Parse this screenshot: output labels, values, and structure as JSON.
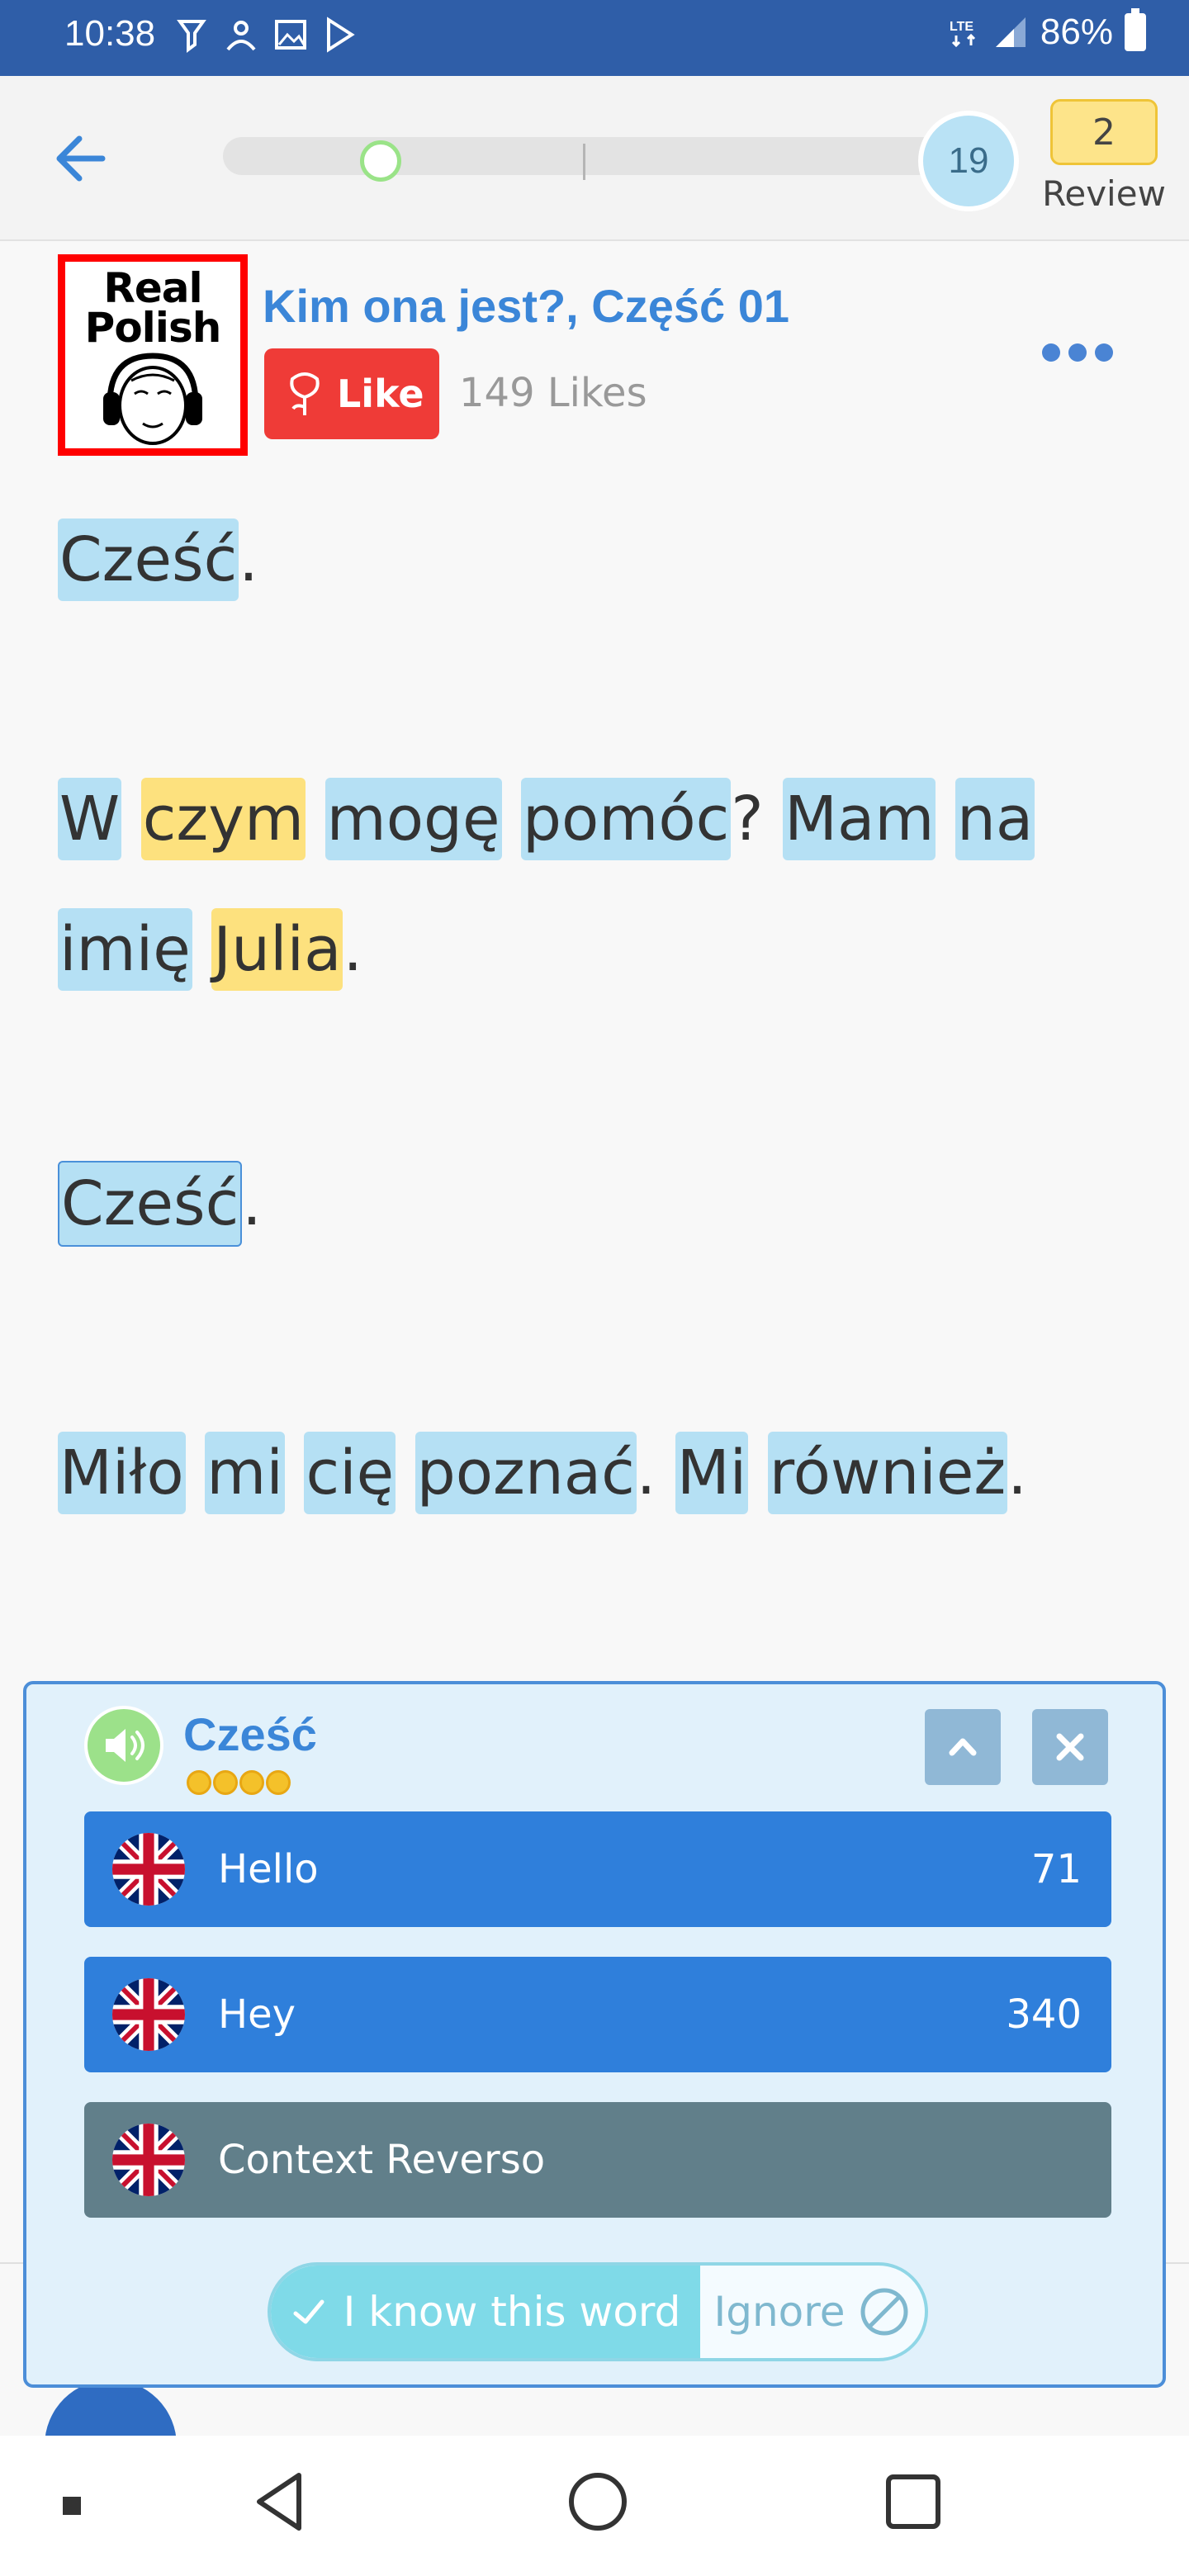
{
  "status_bar": {
    "time": "10:38",
    "battery": "86%"
  },
  "header": {
    "level": "19",
    "review_count": "2",
    "review_label": "Review",
    "progress_fraction": 0.22
  },
  "lesson": {
    "title": "Kim ona jest?, Część 01",
    "thumb_text_line1": "Real",
    "thumb_text_line2": "Polish",
    "like_label": "Like",
    "likes_count": "149 Likes",
    "lines": [
      [
        {
          "t": "Cześć",
          "c": "blue"
        },
        {
          "t": ".",
          "c": "p"
        }
      ],
      [
        {
          "t": "W",
          "c": "blue"
        },
        {
          "t": " ",
          "c": "p"
        },
        {
          "t": "czym",
          "c": "yellow"
        },
        {
          "t": " ",
          "c": "p"
        },
        {
          "t": "mogę",
          "c": "blue"
        },
        {
          "t": " ",
          "c": "p"
        },
        {
          "t": "pomóc",
          "c": "blue"
        },
        {
          "t": "? ",
          "c": "p"
        },
        {
          "t": "Mam",
          "c": "blue"
        },
        {
          "t": " ",
          "c": "p"
        },
        {
          "t": "na",
          "c": "blue"
        }
      ],
      [
        {
          "t": "imię",
          "c": "blue"
        },
        {
          "t": " ",
          "c": "p"
        },
        {
          "t": "Julia",
          "c": "yellow"
        },
        {
          "t": ".",
          "c": "p"
        }
      ],
      [
        {
          "t": "Cześć",
          "c": "sel"
        },
        {
          "t": ".",
          "c": "p"
        }
      ],
      [
        {
          "t": "Miło",
          "c": "blue"
        },
        {
          "t": " ",
          "c": "p"
        },
        {
          "t": "mi",
          "c": "blue"
        },
        {
          "t": " ",
          "c": "p"
        },
        {
          "t": "cię",
          "c": "blue"
        },
        {
          "t": " ",
          "c": "p"
        },
        {
          "t": "poznać",
          "c": "blue"
        },
        {
          "t": ". ",
          "c": "p"
        },
        {
          "t": "Mi",
          "c": "blue"
        },
        {
          "t": " ",
          "c": "p"
        },
        {
          "t": "również",
          "c": "blue"
        },
        {
          "t": ".",
          "c": "p"
        }
      ]
    ]
  },
  "popup": {
    "word": "Cześć",
    "translations": [
      {
        "label": "Hello",
        "count": "71"
      },
      {
        "label": "Hey",
        "count": "340"
      }
    ],
    "context_label": "Context Reverso",
    "know_label": "I know this word",
    "ignore_label": "Ignore"
  },
  "colors": {
    "status_bar": "#2f5ea8",
    "accent_blue": "#3b86d8",
    "like_red": "#ef3b37",
    "highlight_blue": "#b5e0f4",
    "highlight_yellow": "#fde17e"
  },
  "icons": [
    "back-arrow-icon",
    "rose-icon",
    "more-dots-icon",
    "speaker-icon",
    "chevron-up-icon",
    "close-icon",
    "uk-flag-icon",
    "check-icon",
    "ignore-icon",
    "nav-back-icon",
    "nav-home-icon",
    "nav-recents-icon"
  ]
}
